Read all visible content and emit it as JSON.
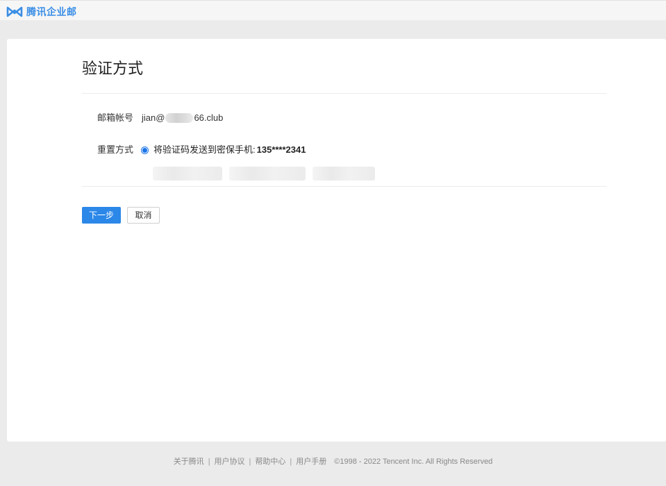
{
  "header": {
    "logo_text": "腾讯企业邮"
  },
  "main": {
    "title": "验证方式",
    "email_label": "邮箱帐号",
    "email_prefix": "jian@",
    "email_suffix": "66.club",
    "reset_label": "重置方式",
    "reset_option_text": "将验证码发送到密保手机:",
    "reset_option_phone": "135****2341",
    "next_button": "下一步",
    "cancel_button": "取消"
  },
  "footer": {
    "links": [
      "关于腾讯",
      "用户协议",
      "帮助中心",
      "用户手册"
    ],
    "separator": "|",
    "copyright": "©1998 - 2022 Tencent Inc. All Rights Reserved"
  },
  "colors": {
    "accent": "#2b87e8",
    "logo": "#3a8ee6"
  }
}
